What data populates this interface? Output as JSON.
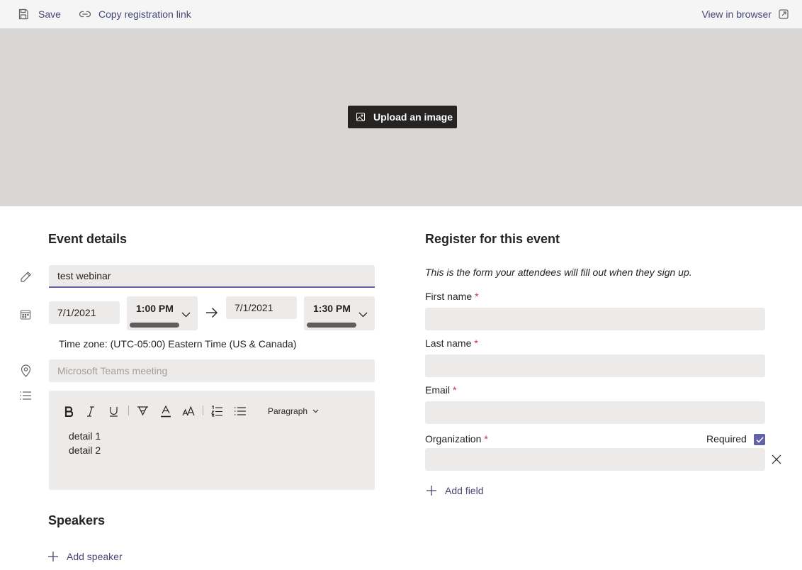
{
  "toolbar": {
    "save_label": "Save",
    "copy_label": "Copy registration link",
    "view_label": "View in browser"
  },
  "banner": {
    "upload_label": "Upload an image"
  },
  "event_details": {
    "heading": "Event details",
    "title_value": "test webinar",
    "start_date": "7/1/2021",
    "start_time": "1:00 PM",
    "end_date": "7/1/2021",
    "end_time": "1:30 PM",
    "timezone": "Time zone: (UTC-05:00) Eastern Time (US & Canada)",
    "location_placeholder": "Microsoft Teams meeting",
    "editor": {
      "paragraph_label": "Paragraph",
      "lines": [
        "detail 1",
        "detail 2"
      ]
    }
  },
  "speakers": {
    "heading": "Speakers",
    "add_label": "Add speaker"
  },
  "registration": {
    "heading": "Register for this event",
    "subtitle": "This is the form your attendees will fill out when they sign up.",
    "fields": [
      {
        "label": "First name",
        "required_mark": "*"
      },
      {
        "label": "Last name",
        "required_mark": "*"
      },
      {
        "label": "Email",
        "required_mark": "*"
      },
      {
        "label": "Organization",
        "required_mark": "*"
      }
    ],
    "required_label": "Required",
    "required_checked": true,
    "add_field_label": "Add field"
  },
  "colors": {
    "accent": "#6264a7",
    "accent_text": "#464775",
    "required": "#c4314b",
    "banner": "#d9d7d5",
    "input_bg": "#edebe9"
  },
  "icons": [
    "save-icon",
    "link-icon",
    "open-external-icon",
    "image-icon",
    "pencil-icon",
    "calendar-icon",
    "location-pin-icon",
    "list-icon",
    "chevron-down-icon",
    "arrow-right-icon",
    "plus-icon",
    "close-icon",
    "check-icon"
  ]
}
